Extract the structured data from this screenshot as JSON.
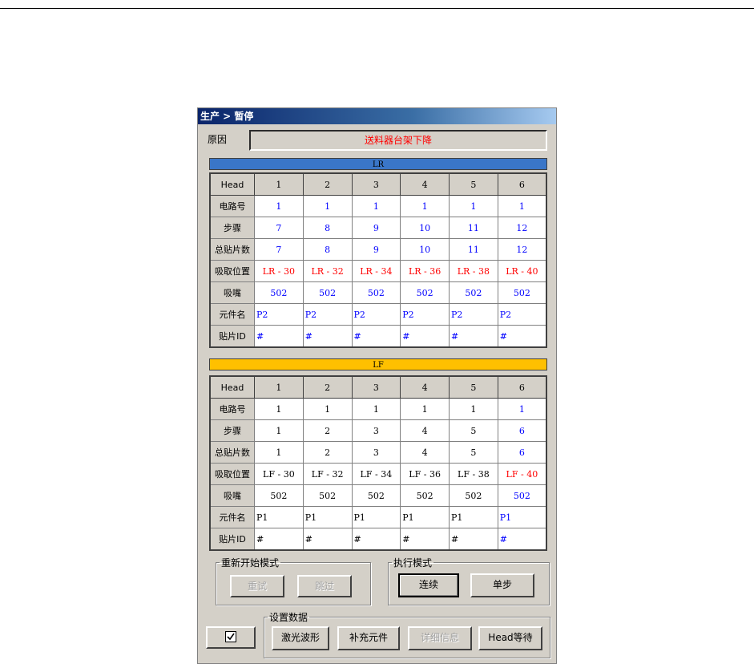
{
  "window": {
    "title": "生产 > 暂停"
  },
  "reason": {
    "label": "原因",
    "value": "送料器台架下降"
  },
  "lr": {
    "name": "LR",
    "header": [
      "Head",
      "1",
      "2",
      "3",
      "4",
      "5",
      "6"
    ],
    "rows": [
      {
        "label": "电路号",
        "cells": [
          "1",
          "1",
          "1",
          "1",
          "1",
          "1"
        ]
      },
      {
        "label": "步骤",
        "cells": [
          "7",
          "8",
          "9",
          "10",
          "11",
          "12"
        ]
      },
      {
        "label": "总贴片数",
        "cells": [
          "7",
          "8",
          "9",
          "10",
          "11",
          "12"
        ]
      },
      {
        "label": "吸取位置",
        "cells": [
          "LR - 30",
          "LR - 32",
          "LR - 34",
          "LR - 36",
          "LR - 38",
          "LR - 40"
        ]
      },
      {
        "label": "吸嘴",
        "cells": [
          "502",
          "502",
          "502",
          "502",
          "502",
          "502"
        ]
      },
      {
        "label": "元件名",
        "cells": [
          "P2",
          "P2",
          "P2",
          "P2",
          "P2",
          "P2"
        ]
      },
      {
        "label": "贴片ID",
        "cells": [
          "#",
          "#",
          "#",
          "#",
          "#",
          "#"
        ]
      }
    ]
  },
  "lf": {
    "name": "LF",
    "header": [
      "Head",
      "1",
      "2",
      "3",
      "4",
      "5",
      "6"
    ],
    "rows": [
      {
        "label": "电路号",
        "cells": [
          "1",
          "1",
          "1",
          "1",
          "1",
          "1"
        ]
      },
      {
        "label": "步骤",
        "cells": [
          "1",
          "2",
          "3",
          "4",
          "5",
          "6"
        ]
      },
      {
        "label": "总贴片数",
        "cells": [
          "1",
          "2",
          "3",
          "4",
          "5",
          "6"
        ]
      },
      {
        "label": "吸取位置",
        "cells": [
          "LF - 30",
          "LF - 32",
          "LF - 34",
          "LF - 36",
          "LF - 38",
          "LF - 40"
        ]
      },
      {
        "label": "吸嘴",
        "cells": [
          "502",
          "502",
          "502",
          "502",
          "502",
          "502"
        ]
      },
      {
        "label": "元件名",
        "cells": [
          "P1",
          "P1",
          "P1",
          "P1",
          "P1",
          "P1"
        ]
      },
      {
        "label": "贴片ID",
        "cells": [
          "#",
          "#",
          "#",
          "#",
          "#",
          "#"
        ]
      }
    ]
  },
  "restart_mode": {
    "legend": "重新开始模式",
    "retry": "重试",
    "skip": "跳过"
  },
  "exec_mode": {
    "legend": "执行模式",
    "continuous": "连续",
    "single_step": "单步"
  },
  "settings": {
    "legend": "设置数据",
    "laser_waveform": "激光波形",
    "replenish": "补充元件",
    "details": "详细信息",
    "head_wait": "Head等待"
  },
  "check_button": {
    "icon": "check-icon"
  },
  "colors": {
    "value_blue": "#0000ff",
    "value_red": "#ff0000",
    "lr_bar": "#3a76c8",
    "lf_bar": "#ffc000"
  }
}
